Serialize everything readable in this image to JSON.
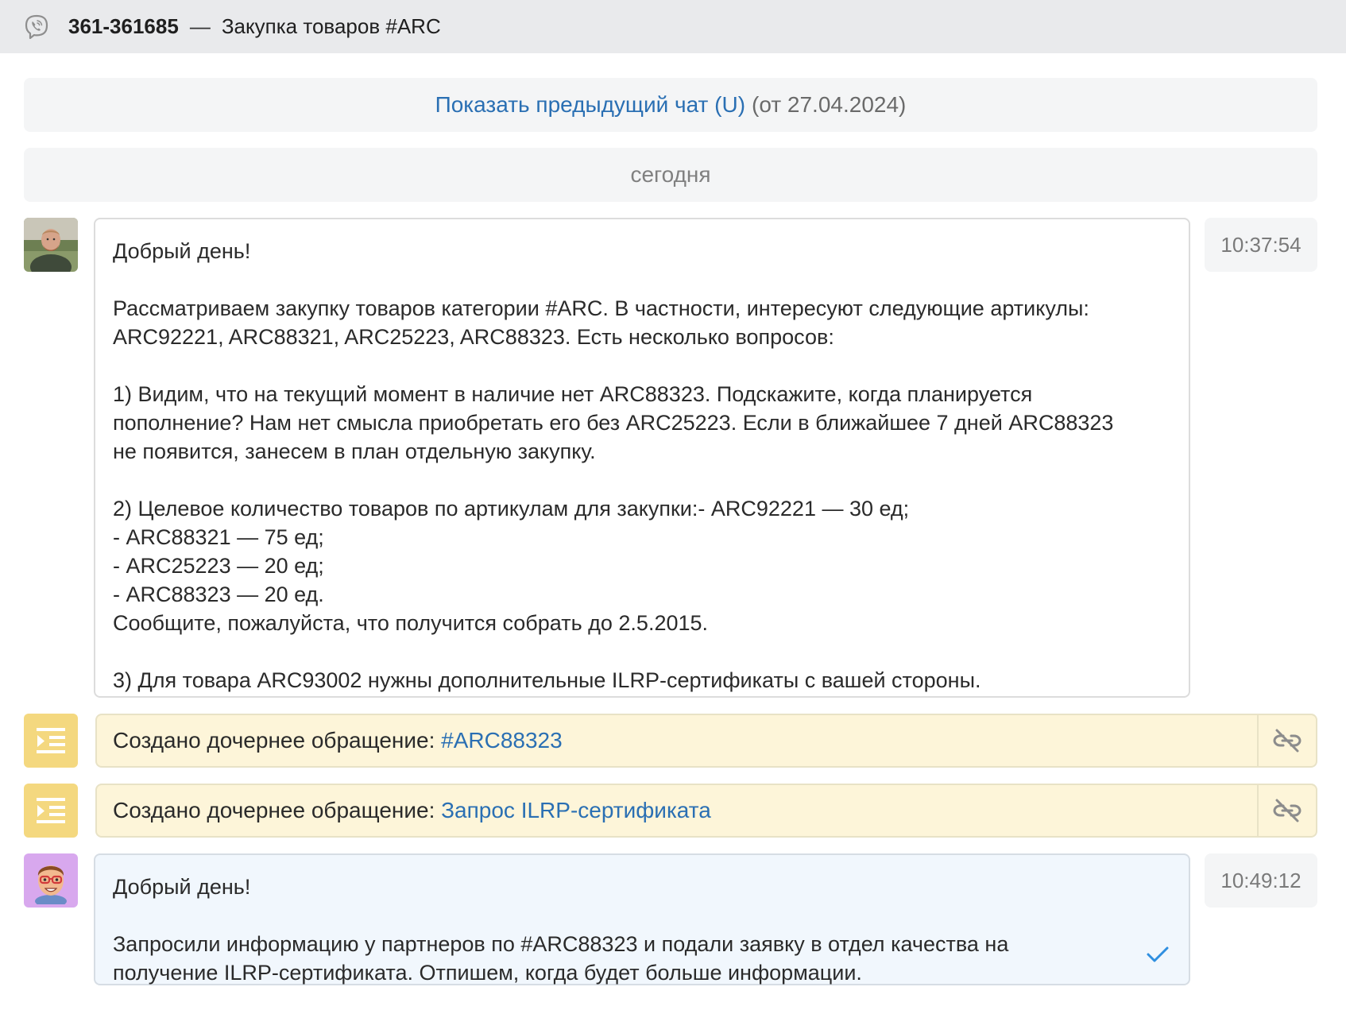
{
  "header": {
    "channel_icon": "viber-icon",
    "number": "361-361685",
    "separator": "—",
    "title": "Закупка товаров #ARC"
  },
  "previous_chat": {
    "link_text": "Показать предыдущий чат (U)",
    "date_text": "(от 27.04.2024)"
  },
  "today_label": "сегодня",
  "messages": [
    {
      "author_avatar": "customer-photo",
      "time": "10:37:54",
      "paragraphs": [
        "Добрый день!",
        "Рассматриваем закупку товаров категории #ARC. В частности, интересуют следующие артикулы:\nARC92221, ARC88321, ARC25223, ARC88323. Есть несколько вопросов:",
        "1) Видим, что на текущий момент в наличие нет ARC88323. Подскажите, когда планируется\nпополнение? Нам нет смысла приобретать его без ARC25223. Если в ближайшее 7 дней ARC88323\nне появится, занесем в план отдельную закупку.",
        "2) Целевое количество товаров по артикулам для закупки:- ARC92221 — 30 ед;\n- ARC88321 — 75 ед;\n- ARC25223 — 20 ед;\n- ARC88323 — 20 ед.\nСообщите, пожалуйста, что получится собрать до 2.5.2015.",
        "3) Для товара ARC93002 нужны дополнительные ILRP-сертификаты с вашей стороны."
      ]
    },
    {
      "author_avatar": "agent-memoji",
      "time": "10:49:12",
      "status_icon": "checkmark-icon",
      "paragraphs": [
        "Добрый день!",
        "Запросили информацию у партнеров по #ARC88323 и подали заявку в отдел качества на\nполучение ILRP-сертификата. Отпишем, когда будет больше информации."
      ]
    }
  ],
  "events": [
    {
      "icon": "subtask-icon",
      "prefix": "Создано дочернее обращение:",
      "link": "#ARC88323",
      "action_icon": "unlink-icon"
    },
    {
      "icon": "subtask-icon",
      "prefix": "Создано дочернее обращение:",
      "link": "Запрос ILRP-сертификата",
      "action_icon": "unlink-icon"
    }
  ],
  "colors": {
    "link": "#2a6fb3",
    "event_bg": "#fdf5d9",
    "task_icon_bg": "#f4d87f",
    "reply_bg": "#f1f7fd",
    "check": "#2f8fe0"
  }
}
